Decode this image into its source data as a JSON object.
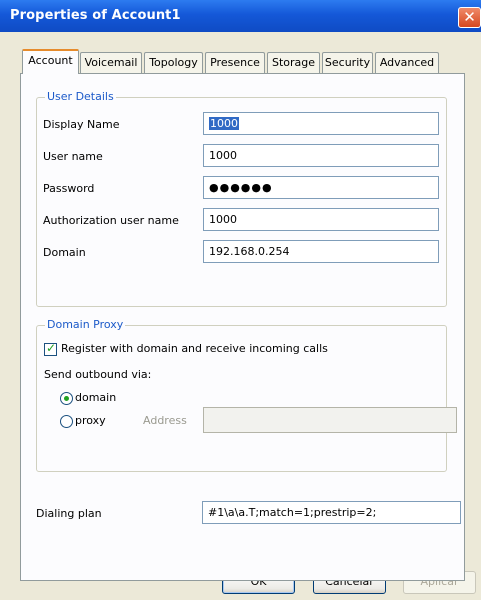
{
  "window": {
    "title": "Properties of Account1",
    "close_glyph": "✕"
  },
  "tabs": [
    {
      "label": "Account"
    },
    {
      "label": "Voicemail"
    },
    {
      "label": "Topology"
    },
    {
      "label": "Presence"
    },
    {
      "label": "Storage"
    },
    {
      "label": "Security"
    },
    {
      "label": "Advanced"
    }
  ],
  "user_details": {
    "title": "User Details",
    "display_name_label": "Display Name",
    "display_name_value": "1000",
    "user_name_label": "User name",
    "user_name_value": "1000",
    "password_label": "Password",
    "password_value": "●●●●●●",
    "auth_user_label": "Authorization user name",
    "auth_user_value": "1000",
    "domain_label": "Domain",
    "domain_value": "192.168.0.254"
  },
  "domain_proxy": {
    "title": "Domain Proxy",
    "register_label": "Register with domain and receive incoming calls",
    "register_checked": true,
    "send_outbound_label": "Send outbound via:",
    "domain_option": "domain",
    "proxy_option": "proxy",
    "selected_option": "domain",
    "address_label": "Address",
    "address_value": ""
  },
  "dialing_plan": {
    "label": "Dialing plan",
    "value": "#1\\a\\a.T;match=1;prestrip=2;"
  },
  "buttons": {
    "ok": "OK",
    "cancel": "Cancelar",
    "apply": "Aplicar"
  },
  "icons": {
    "close": "close-icon",
    "check": "checkmark-icon",
    "radio": "radio-dot-icon"
  },
  "colors": {
    "titlebar": "#1458d8",
    "accent_tab": "#e68b2c",
    "group_title": "#1c5ac9",
    "check": "#21a121"
  }
}
